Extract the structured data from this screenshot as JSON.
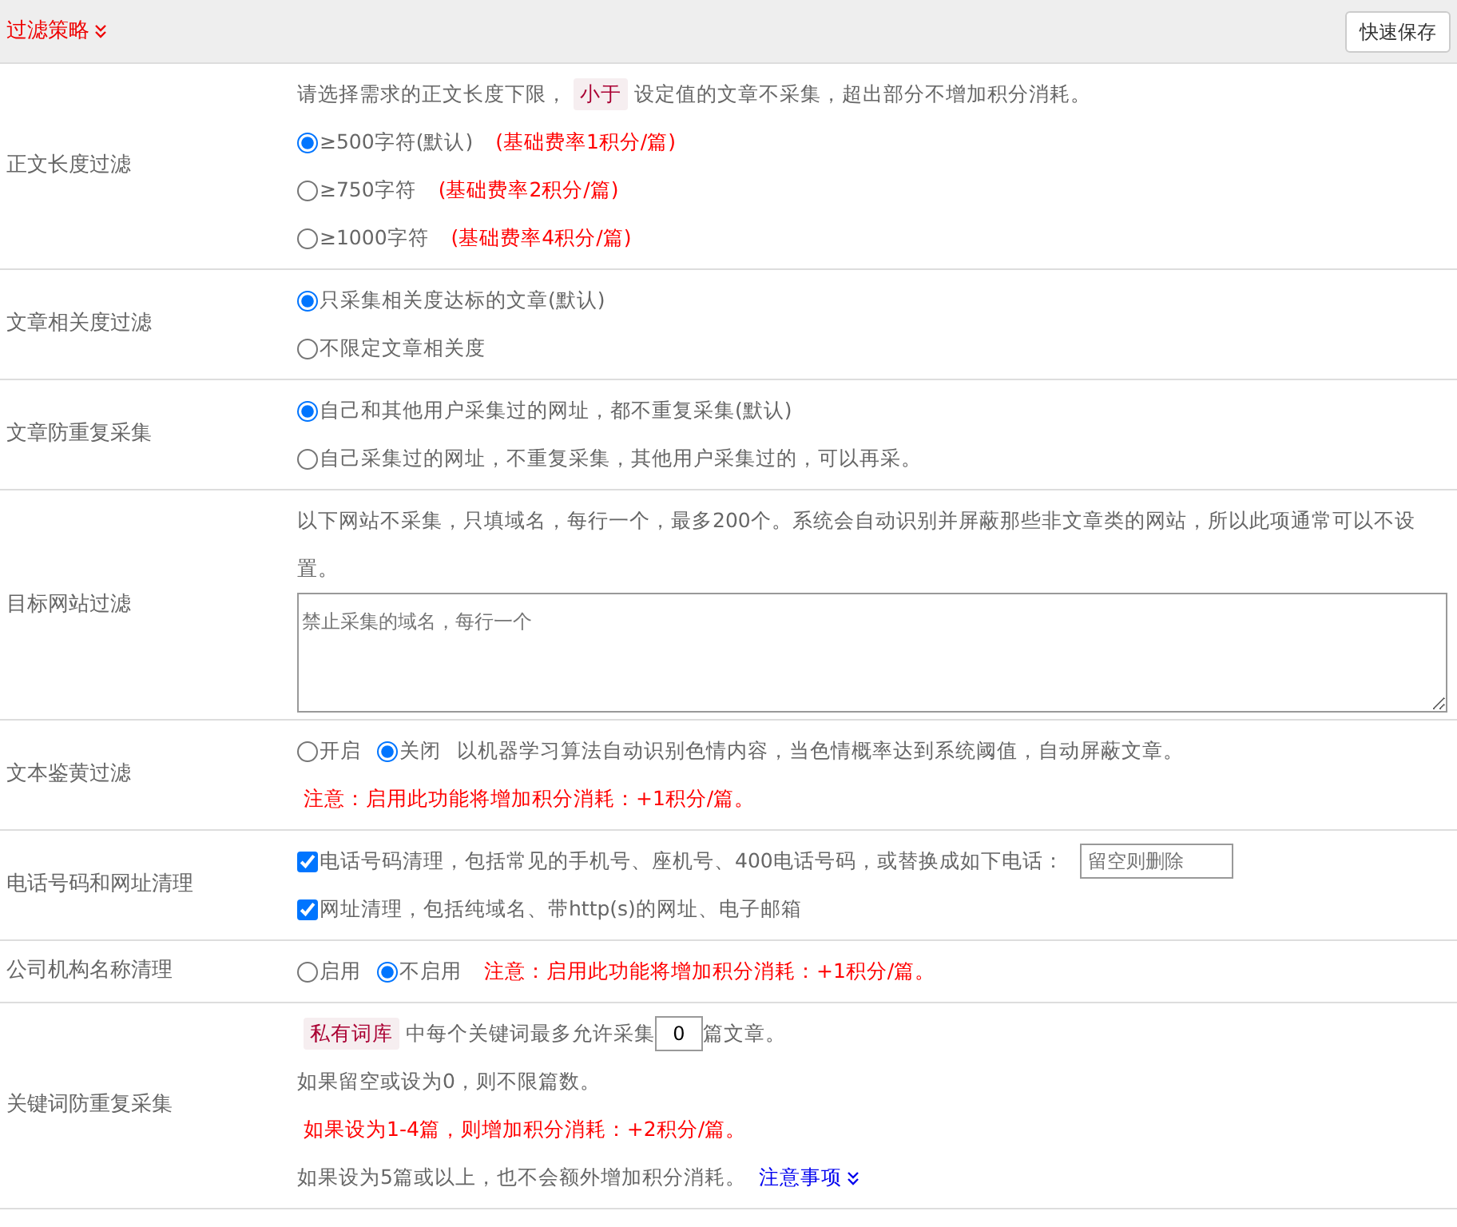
{
  "header": {
    "title": "过滤策略",
    "save_button": "快速保存"
  },
  "rows": [
    {
      "label": "正文长度过滤",
      "lines": [
        [
          {
            "kind": "text",
            "text": "请选择需求的正文长度下限，"
          },
          {
            "kind": "tag",
            "text": "小于"
          },
          {
            "kind": "text",
            "text": "设定值的文章不采集，超出部分不增加积分消耗。"
          }
        ],
        [
          {
            "kind": "radio",
            "label": "≥500字符(默认)",
            "selected": true
          },
          {
            "kind": "warn",
            "text": "(基础费率1积分/篇)"
          }
        ],
        [
          {
            "kind": "radio",
            "label": "≥750字符",
            "selected": false
          },
          {
            "kind": "warn",
            "text": "(基础费率2积分/篇)"
          }
        ],
        [
          {
            "kind": "radio",
            "label": "≥1000字符",
            "selected": false
          },
          {
            "kind": "warn",
            "text": "(基础费率4积分/篇)"
          }
        ]
      ]
    },
    {
      "label": "文章相关度过滤",
      "lines": [
        [
          {
            "kind": "radio",
            "label": "只采集相关度达标的文章(默认)",
            "selected": true
          }
        ],
        [
          {
            "kind": "radio",
            "label": "不限定文章相关度",
            "selected": false
          }
        ]
      ]
    },
    {
      "label": "文章防重复采集",
      "lines": [
        [
          {
            "kind": "radio",
            "label": "自己和其他用户采集过的网址，都不重复采集(默认)",
            "selected": true
          }
        ],
        [
          {
            "kind": "radio",
            "label": "自己采集过的网址，不重复采集，其他用户采集过的，可以再采。",
            "selected": false
          }
        ]
      ]
    },
    {
      "label": "目标网站过滤",
      "lines": [
        [
          {
            "kind": "text",
            "text": "以下网站不采集，只填域名，每行一个，最多200个。系统会自动识别并屏蔽那些非文章类的网站，所以此项通常可以不设置。"
          }
        ],
        [
          {
            "kind": "textarea",
            "placeholder": "禁止采集的域名，每行一个"
          }
        ]
      ]
    },
    {
      "label": "文本鉴黄过滤",
      "lines": [
        [
          {
            "kind": "radio",
            "label": "开启",
            "selected": false
          },
          {
            "kind": "radio",
            "label": "关闭",
            "selected": true
          },
          {
            "kind": "text",
            "text": "以机器学习算法自动识别色情内容，当色情概率达到系统阈值，自动屏蔽文章。"
          }
        ],
        [
          {
            "kind": "warn",
            "text": "注意：启用此功能将增加积分消耗：+1积分/篇。"
          }
        ]
      ]
    },
    {
      "label": "电话号码和网址清理",
      "lines": [
        [
          {
            "kind": "checkbox",
            "label": "电话号码清理，包括常见的手机号、座机号、400电话号码，或替换成如下电话：",
            "checked": true
          },
          {
            "kind": "input",
            "placeholder": "留空则删除"
          }
        ],
        [
          {
            "kind": "checkbox",
            "label": "网址清理，包括纯域名、带http(s)的网址、电子邮箱",
            "checked": true
          }
        ]
      ]
    },
    {
      "label": "公司机构名称清理",
      "lines": [
        [
          {
            "kind": "radio",
            "label": "启用",
            "selected": false
          },
          {
            "kind": "radio",
            "label": "不启用",
            "selected": true
          },
          {
            "kind": "warn",
            "text": "注意：启用此功能将增加积分消耗：+1积分/篇。"
          }
        ]
      ]
    },
    {
      "label": "关键词防重复采集",
      "lines": [
        [
          {
            "kind": "tag",
            "text": "私有词库"
          },
          {
            "kind": "text",
            "text": "中每个关键词最多允许采集"
          },
          {
            "kind": "input",
            "value": "0"
          },
          {
            "kind": "text",
            "text": "篇文章。"
          }
        ],
        [
          {
            "kind": "text",
            "text": "如果留空或设为0，则不限篇数。"
          }
        ],
        [
          {
            "kind": "warn",
            "text": "如果设为1-4篇，则增加积分消耗：+2积分/篇。"
          }
        ],
        [
          {
            "kind": "text",
            "text": "如果设为5篇或以上，也不会额外增加积分消耗。"
          },
          {
            "kind": "link",
            "text": "注意事项"
          }
        ]
      ]
    }
  ]
}
